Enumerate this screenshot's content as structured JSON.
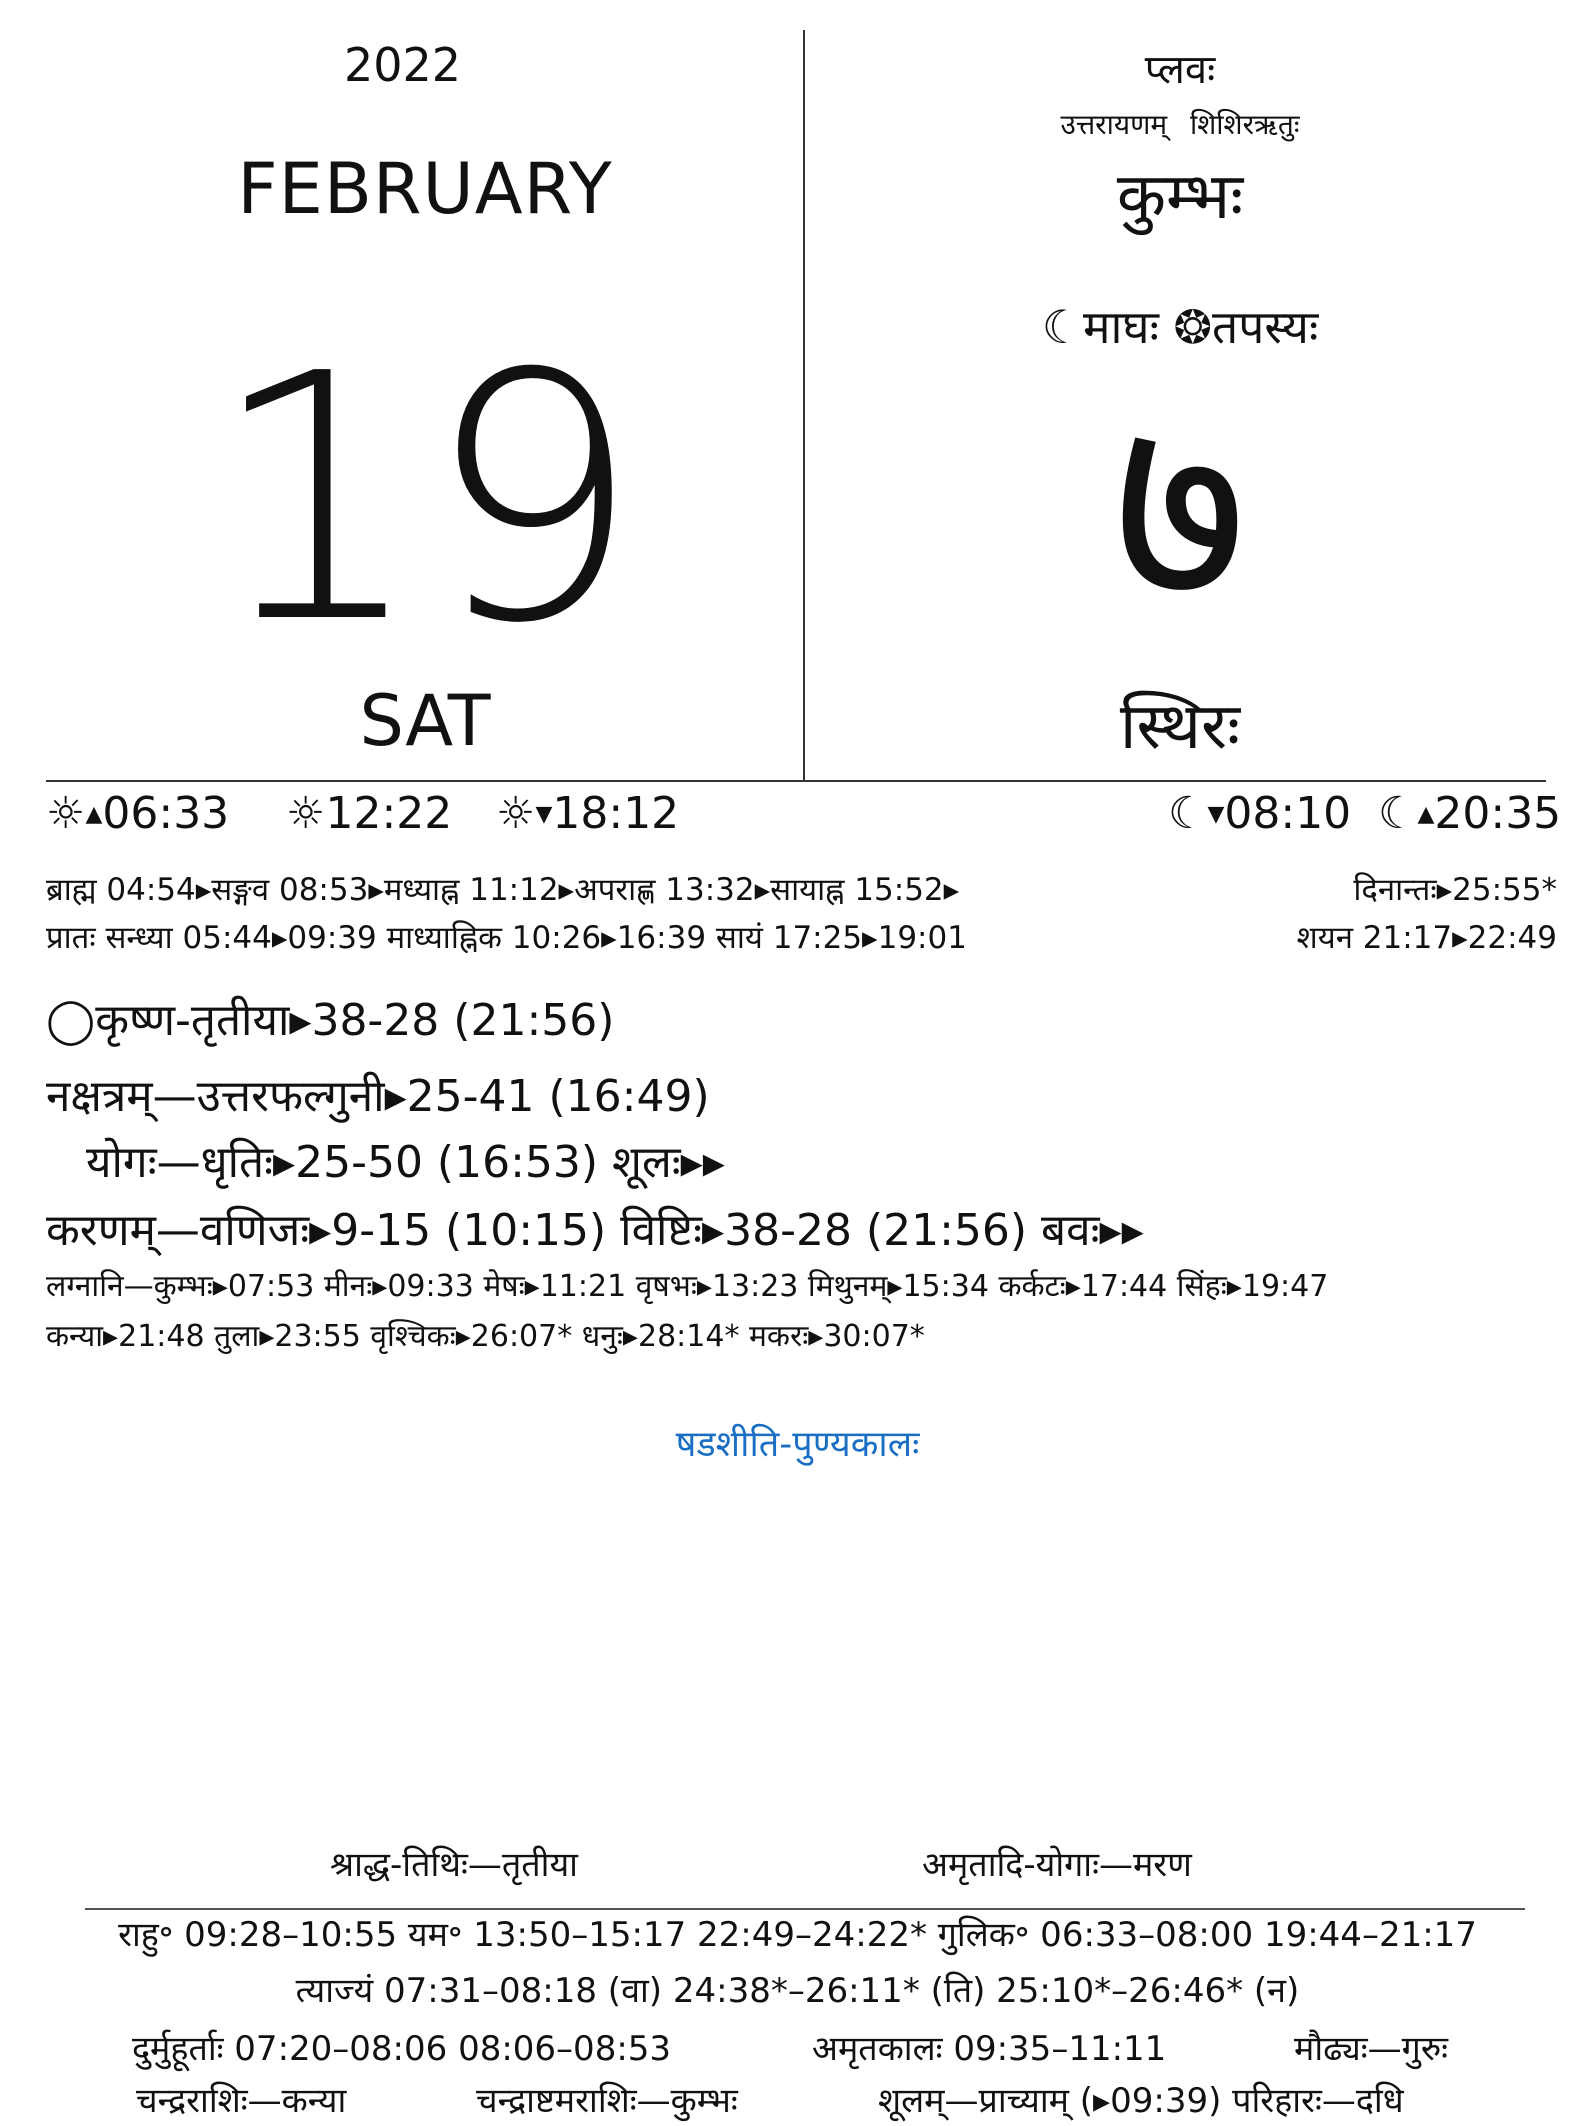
{
  "left_panel": {
    "year": "2022",
    "month": "FEBRUARY",
    "day": "19",
    "weekday": "SAT"
  },
  "right_panel": {
    "samvatsara": "प्लवः",
    "ayana_ritu": "उत्तरायणम्   शिशिरऋतुः",
    "rashi": "कुम्भः",
    "masa": "☾माघः ❂तपस्यः",
    "tithi_number": "७",
    "vara": "स्थिरः"
  },
  "sun_moon": {
    "sunrise": "06:33",
    "noon": "12:22",
    "sunset": "18:12",
    "moonset": "08:10",
    "moonrise": "20:35",
    "sunrise_icon": "sunrise-icon",
    "noon_icon": "sun-icon",
    "sunset_icon": "sunset-icon",
    "moonset_icon": "moonset-icon",
    "moonrise_icon": "moonrise-icon"
  },
  "kala_lines": {
    "line1_left": "ब्राह्म 04:54▸सङ्गव 08:53▸मध्याह्न 11:12▸अपराह्ण 13:32▸सायाह्न 15:52▸",
    "line1_right": "दिनान्तः▸25:55*",
    "line2_left": "प्रातः सन्ध्या 05:44▸09:39 माध्याह्निक 10:26▸16:39 सायं 17:25▸19:01",
    "line2_right": "शयन 21:17▸22:49"
  },
  "panchanga": {
    "tithi": "◯कृष्ण-तृतीया▸38-28 (21:56)",
    "nakshatra": "नक्षत्रम्—उत्तरफल्गुनी▸25-41 (16:49)",
    "yoga": "योगः—धृतिः▸25-50 (16:53)  शूलः▸▸",
    "karana": "करणम्—वणिजः▸9-15 (10:15)  विष्टिः▸38-28 (21:56)  बवः▸▸",
    "lagna_line1": "लग्नानि—कुम्भः▸07:53  मीनः▸09:33  मेषः▸11:21  वृषभः▸13:23  मिथुनम्▸15:34  कर्कटः▸17:44  सिंहः▸19:47",
    "lagna_line2": "कन्या▸21:48 तुला▸23:55 वृश्चिकः▸26:07* धनुः▸28:14* मकरः▸30:07*"
  },
  "special_event": "षडशीति-पुण्यकालः",
  "footer": {
    "shraddha": "श्राद्ध-तिथिः—तृतीया",
    "amrutadi": "अमृतादि-योगाः—मरण",
    "line1": "राहु॰ 09:28–10:55   यम॰ 13:50–15:17  22:49–24:22*   गुलिक॰ 06:33–08:00  19:44–21:17",
    "line2": "त्याज्यं 07:31–08:18 (वा)    24:38*–26:11* (ति)    25:10*–26:46* (न)",
    "line3_a": "दुर्मुहूर्ताः 07:20–08:06    08:06–08:53",
    "line3_b": "अमृतकालः 09:35–11:11",
    "line3_c": "मौढ्यः—गुरुः",
    "line4_a": "चन्द्रराशिः—कन्या",
    "line4_b": "चन्द्राष्टमराशिः—कुम्भः",
    "line4_c": "शूलम्—प्राच्याम् (▸09:39) परिहारः—दधि"
  }
}
